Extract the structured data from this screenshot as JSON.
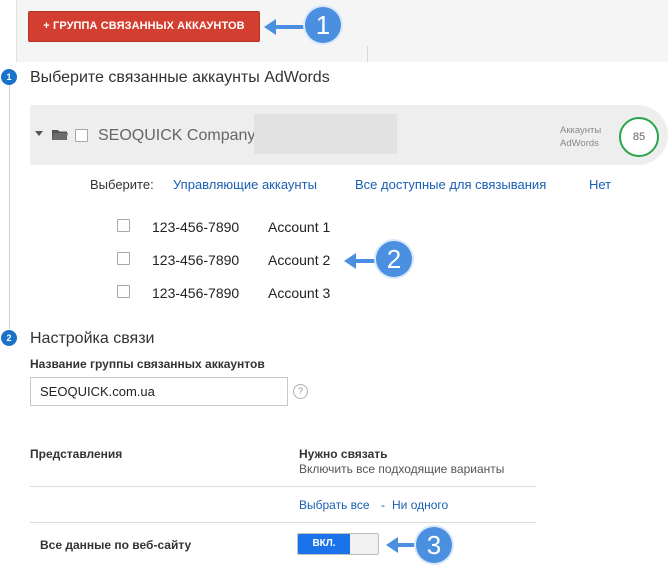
{
  "toolbar": {
    "add_button_label": "+ ГРУППА СВЯЗАННЫХ АККАУНТОВ"
  },
  "annotations": [
    "1",
    "2",
    "3"
  ],
  "step1": {
    "number": "1",
    "title": "Выберите связанные аккаунты AdWords",
    "company_name": "SEOQUICK Company",
    "adwords_label_line1": "Аккаунты",
    "adwords_label_line2": "AdWords",
    "adwords_count": "85",
    "select_label": "Выберите:",
    "filters": [
      "Управляющие аккаунты",
      "Все доступные для связывания",
      "Нет"
    ],
    "accounts": [
      {
        "id": "123-456-7890",
        "name": "Account 1"
      },
      {
        "id": "123-456-7890",
        "name": "Account 2"
      },
      {
        "id": "123-456-7890",
        "name": "Account 3"
      }
    ]
  },
  "step2": {
    "number": "2",
    "title": "Настройка связи",
    "group_name_label": "Название группы связанных аккаунтов",
    "group_name_value": "SEOQUICK.com.ua",
    "help_icon_text": "?",
    "views_header": "Представления",
    "link_header": "Нужно связать",
    "link_subheader": "Включить все подходящие варианты",
    "select_all": "Выбрать все",
    "separator": "-",
    "select_none": "Ни одного",
    "row_label": "Все данные по веб-сайту",
    "toggle_label": "ВКЛ."
  },
  "colors": {
    "add_button": "#d23f31",
    "marker": "#4a8fe0",
    "step_dot": "#1a73c8",
    "link": "#1a5fb4",
    "count_ring": "#2aa54a",
    "toggle_on": "#1a73e8"
  }
}
